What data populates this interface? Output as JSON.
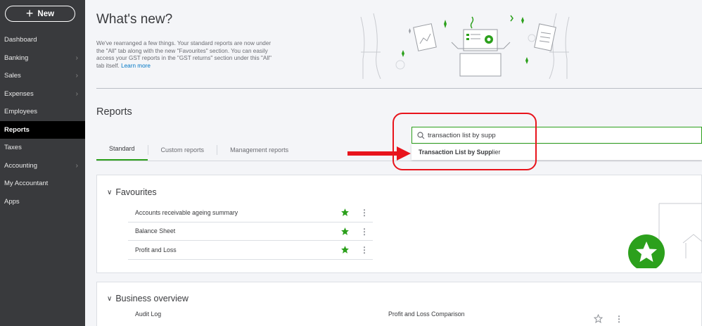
{
  "sidebar": {
    "new_label": "New",
    "items": [
      {
        "label": "Dashboard",
        "chevron": false
      },
      {
        "label": "Banking",
        "chevron": true
      },
      {
        "label": "Sales",
        "chevron": true
      },
      {
        "label": "Expenses",
        "chevron": true
      },
      {
        "label": "Employees",
        "chevron": false
      },
      {
        "label": "Reports",
        "chevron": false,
        "active": true
      },
      {
        "label": "Taxes",
        "chevron": false
      },
      {
        "label": "Accounting",
        "chevron": true
      },
      {
        "label": "My Accountant",
        "chevron": false
      },
      {
        "label": "Apps",
        "chevron": false
      }
    ]
  },
  "whats_new": {
    "title": "What's new?",
    "text": "We've rearranged a few things. Your standard reports are now under the \"All\" tab along with the new \"Favourites\" section. You can easily access your GST reports in the \"GST returns\" section under this \"All\" tab itself.",
    "link": "Learn more"
  },
  "reports": {
    "title": "Reports",
    "tabs": [
      "Standard",
      "Custom reports",
      "Management reports"
    ],
    "active_tab": "Standard"
  },
  "search": {
    "value": "transaction list by supp",
    "suggestion_match": "Transaction List by Supp",
    "suggestion_rest": "lier"
  },
  "favourites": {
    "title": "Favourites",
    "items": [
      "Accounts receivable ageing summary",
      "Balance Sheet",
      "Profit and Loss"
    ]
  },
  "business_overview": {
    "title": "Business overview",
    "left_item": "Audit Log",
    "right_item": "Profit and Loss Comparison"
  },
  "colors": {
    "sidebar_bg": "#393a3d",
    "accent_green": "#2ca01c",
    "annotation_red": "#e8141c",
    "link_blue": "#0077c5"
  }
}
